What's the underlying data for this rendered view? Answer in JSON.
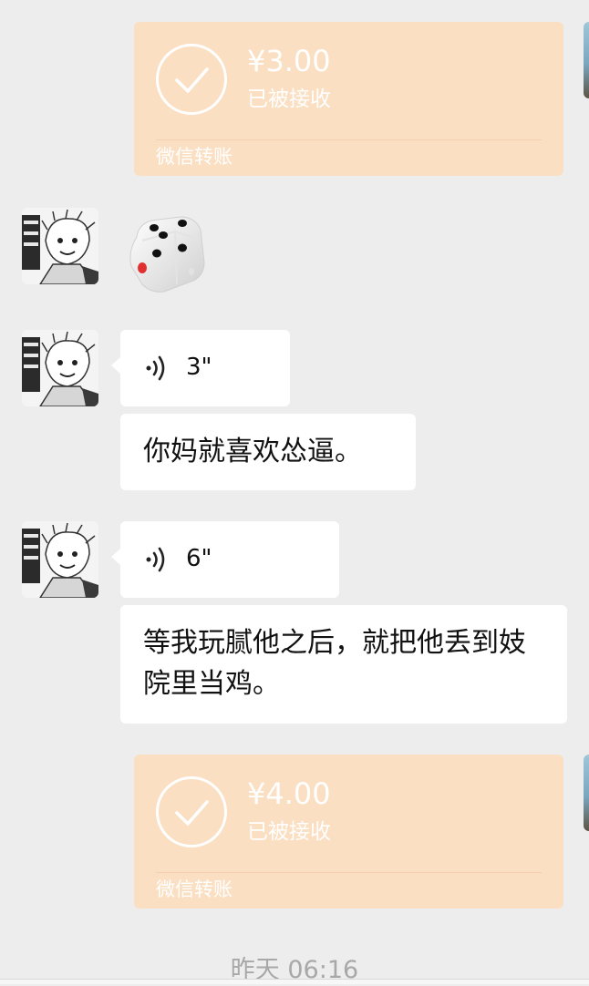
{
  "messages": {
    "transfer1": {
      "amount": "¥3.00",
      "status": "已被接收",
      "brand": "微信转账"
    },
    "voice1": {
      "duration": "3\""
    },
    "text1": "你妈就喜欢怂逼。",
    "voice2": {
      "duration": "6\""
    },
    "text2": "等我玩腻他之后，就把他丢到妓院里当鸡。",
    "transfer2": {
      "amount": "¥4.00",
      "status": "已被接收",
      "brand": "微信转账"
    }
  },
  "timestamp": "昨天 06:16",
  "colors": {
    "background": "#ededed",
    "transfer_card": "#fbdfc2",
    "bubble": "#ffffff"
  },
  "icons": {
    "dice": "dice-icon",
    "voice": "voice-wave-icon",
    "check": "check-circle-icon"
  }
}
